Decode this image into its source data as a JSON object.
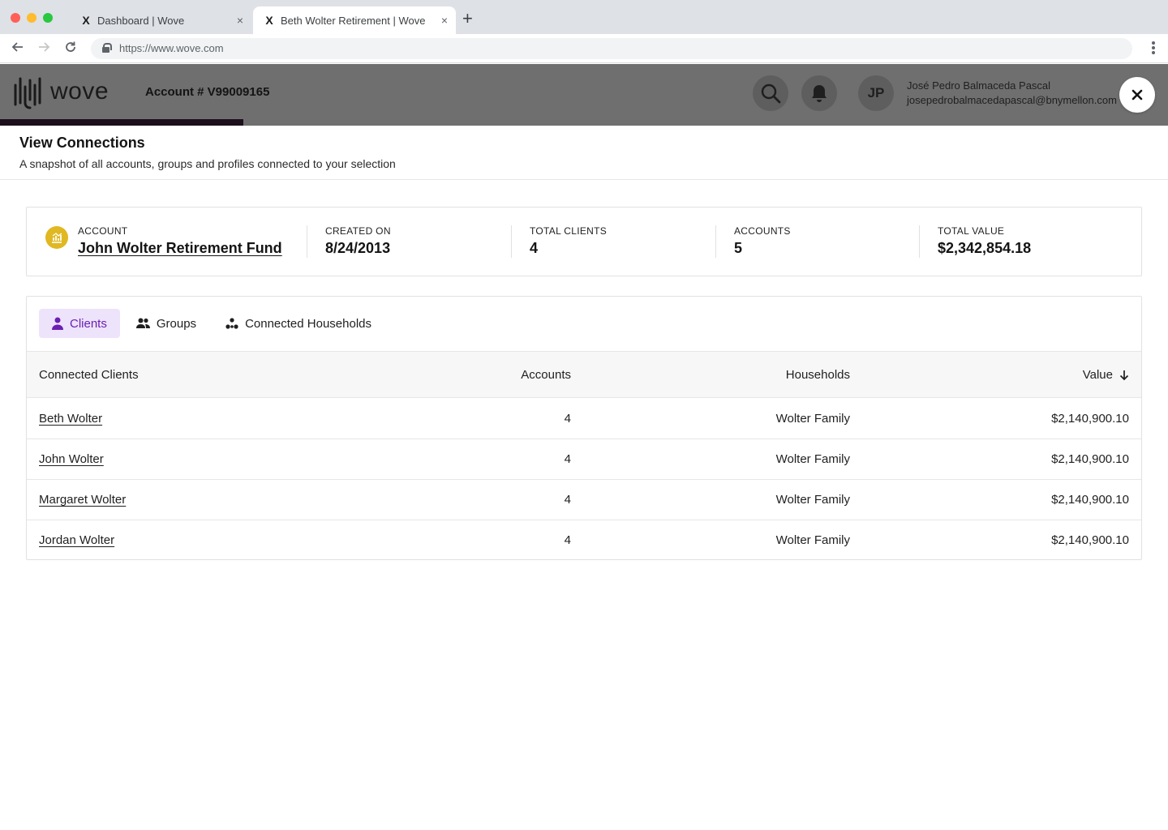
{
  "browser": {
    "tabs": [
      {
        "favicon": "X",
        "title": "Dashboard | Wove",
        "close": "×"
      },
      {
        "favicon": "X",
        "title": "Beth Wolter Retirement | Wove",
        "close": "×"
      }
    ],
    "new_tab": "+",
    "url": "https://www.wove.com"
  },
  "header": {
    "logo_text": "wove",
    "account_number": "Account # V99009165",
    "avatar_initials": "JP",
    "user_name": "José Pedro Balmaceda Pascal",
    "user_email": "josepedrobalmacedapascal@bnymellon.com"
  },
  "modal": {
    "title": "View Connections",
    "subtitle": "A snapshot of all accounts, groups and profiles connected to your selection",
    "summary": {
      "account_label": "ACCOUNT",
      "account_name": "John Wolter Retirement Fund",
      "created_label": "CREATED ON",
      "created_value": "8/24/2013",
      "clients_label": "TOTAL CLIENTS",
      "clients_value": "4",
      "accounts_label": "ACCOUNTS",
      "accounts_value": "5",
      "value_label": "TOTAL VALUE",
      "value_value": "$2,342,854.18"
    },
    "tabs": [
      {
        "label": "Clients",
        "icon": "person-icon",
        "active": true
      },
      {
        "label": "Groups",
        "icon": "people-icon",
        "active": false
      },
      {
        "label": "Connected Households",
        "icon": "network-icon",
        "active": false
      }
    ],
    "table": {
      "columns": [
        "Connected Clients",
        "Accounts",
        "Households",
        "Value"
      ],
      "sort_column": "Value",
      "sort_direction": "descending",
      "rows": [
        {
          "name": "Beth Wolter",
          "accounts": "4",
          "household": "Wolter Family",
          "value": "$2,140,900.10"
        },
        {
          "name": "John Wolter",
          "accounts": "4",
          "household": "Wolter Family",
          "value": "$2,140,900.10"
        },
        {
          "name": "Margaret Wolter",
          "accounts": "4",
          "household": "Wolter Family",
          "value": "$2,140,900.10"
        },
        {
          "name": "Jordan Wolter",
          "accounts": "4",
          "household": "Wolter Family",
          "value": "$2,140,900.10"
        }
      ]
    }
  },
  "colors": {
    "accent_purple": "#6b1fb3",
    "active_tab_bg": "#ede3fb",
    "account_icon": "#e0b821",
    "overlay_header": "#6f6f6f"
  }
}
